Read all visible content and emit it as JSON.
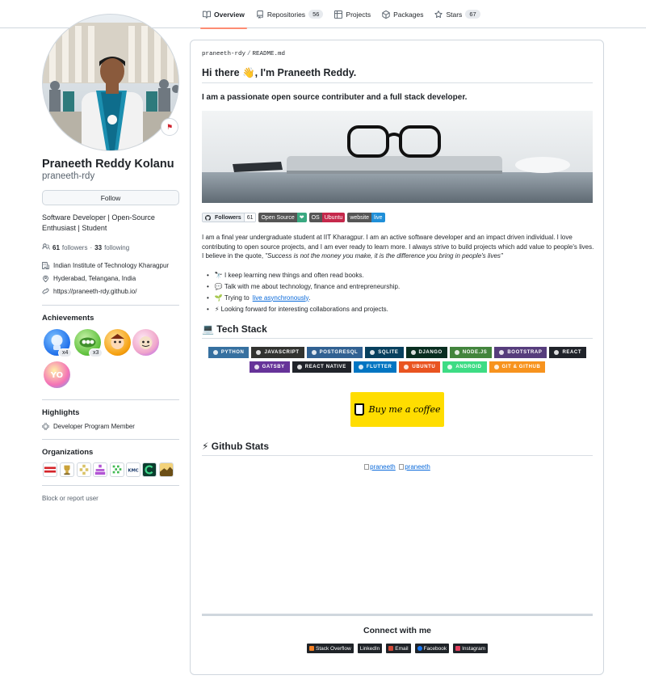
{
  "tabs": [
    {
      "label": "Overview",
      "icon": "book-icon",
      "active": true
    },
    {
      "label": "Repositories",
      "icon": "repo-icon",
      "count": "56"
    },
    {
      "label": "Projects",
      "icon": "table-icon"
    },
    {
      "label": "Packages",
      "icon": "package-icon"
    },
    {
      "label": "Stars",
      "icon": "star-icon",
      "count": "67"
    }
  ],
  "profile": {
    "name": "Praneeth Reddy Kolanu",
    "login": "praneeth-rdy",
    "follow_label": "Follow",
    "bio": "Software Developer | Open-Source Enthusiast | Student",
    "followers_count": "61",
    "followers_label": "followers",
    "separator": "·",
    "following_count": "33",
    "following_label": "following",
    "organization": "Indian Institute of Technology Kharagpur",
    "location": "Hyderabad, Telangana, India",
    "website": "https://praneeth-rdy.github.io/"
  },
  "achievements": {
    "heading": "Achievements",
    "count_1": "x4",
    "count_2": "x3"
  },
  "highlights": {
    "heading": "Highlights",
    "item": "Developer Program Member"
  },
  "organizations": {
    "heading": "Organizations"
  },
  "block_label": "Block or report user",
  "readme": {
    "crumb_user": "praneeth-rdy",
    "crumb_sep": "/",
    "crumb_file": "README.md",
    "title": "Hi there 👋, I'm Praneeth Reddy.",
    "subtitle": "I am a passionate open source contributer and a full stack developer.",
    "shields": {
      "followers_label": "Followers",
      "followers_count": "61",
      "open_source": "Open Source",
      "os_label": "OS",
      "os_value": "Ubuntu",
      "website_label": "website",
      "website_value": "live"
    },
    "intro_text": "I am a final year undergraduate student at IIT Kharagpur. I am an active software developer and an impact driven individual. I love contributing to open source projects, and I am ever ready to learn more. I always strive to build projects which add value to people's lives. I believe in the quote, ",
    "quote": "\"Success is not the money you make, it is the difference you bring in people's lives\"",
    "bullets": {
      "b1": "🔭 I keep learning new things and often read books.",
      "b2": "💬 Talk with me about technology, finance and entrepreneurship.",
      "b3_prefix": "🌱 Trying to",
      "b3_link": "live asynchronously",
      "b3_suffix": ".",
      "b4": "⚡ Looking forward for interesting collaborations and projects."
    },
    "tech_heading": "💻 Tech Stack",
    "tech_row1": [
      "PYTHON",
      "JAVASCRIPT",
      "POSTGRESQL",
      "SQLITE",
      "DJANGO",
      "NODE.JS",
      "BOOTSTRAP",
      "REACT"
    ],
    "tech_row2": [
      "GATSBY",
      "REACT NATIVE",
      "FLUTTER",
      "UBUNTU",
      "ANDROID",
      "GIT & GITHUB"
    ],
    "tech_colors1": [
      "#3670A0",
      "#323330",
      "#316192",
      "#07405e",
      "#092E20",
      "#43853D",
      "#563D7C",
      "#20232a"
    ],
    "tech_colors2": [
      "#663399",
      "#20232a",
      "#0175C2",
      "#E95420",
      "#3DDC84",
      "#F7931E"
    ],
    "bmc_label": "Buy me a coffee",
    "stats_heading": "⚡ Github Stats",
    "stats_alt_1": "praneeth",
    "stats_alt_2": "praneeth",
    "connect_heading": "Connect with me",
    "socials": {
      "s1": "Stack Overflow",
      "s2": "LinkedIn",
      "s3": "Email",
      "s4": "Facebook",
      "s5": "Instagram"
    }
  }
}
